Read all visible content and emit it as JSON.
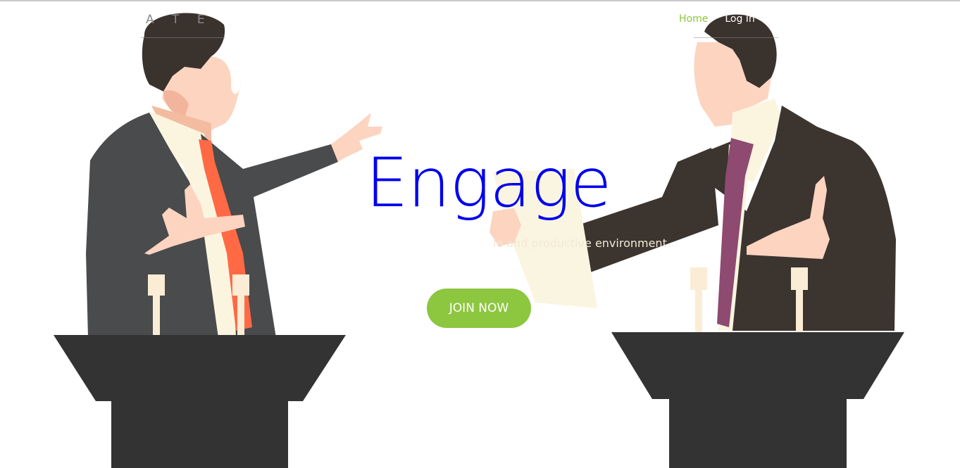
{
  "header": {
    "brand": "A T E",
    "nav": {
      "home": "Home",
      "login": "Log In"
    }
  },
  "hero": {
    "headline": "Engage",
    "tagline": "le and productive environment.",
    "cta_label": "JOIN NOW"
  },
  "colors": {
    "accent": "#8dc63f",
    "headline": "#0000ee",
    "podium": "#333333",
    "left_suit": "#4a4b4d",
    "right_suit": "#3b342f",
    "left_tie": "#ff6a45",
    "right_tie": "#8e4a70",
    "skin": "#f7cdb8",
    "shirt": "#faf5e0"
  }
}
